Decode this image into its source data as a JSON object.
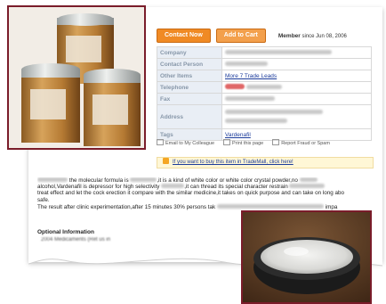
{
  "actions": {
    "contact_label": "Contact Now",
    "cart_label": "Add to Cart",
    "member_bold": "Member",
    "member_text": "since Jun 08, 2006"
  },
  "info_rows": [
    {
      "label": "Company",
      "value": ""
    },
    {
      "label": "Contact Person",
      "value": ""
    },
    {
      "label": "Other Items",
      "value": "More 7 Trade Leads"
    },
    {
      "label": "Telephone",
      "value": ""
    },
    {
      "label": "Fax",
      "value": ""
    },
    {
      "label": "Address",
      "value": ""
    },
    {
      "label": "Tags",
      "value": "Vardenafil"
    }
  ],
  "utility": {
    "email": "Email to My Colleague",
    "print": "Print this page",
    "report": "Report Fraud or Spam"
  },
  "trademall_link": "If you want to buy this item in TradeMall, click here!",
  "description": [
    "the molecular formula is",
    ",it is a kind of white color or white color crystal powder,no",
    "alcohol,Vardenafil is depressor for high selectivity",
    ",it can thread its special character restrain",
    "treat effect and let the cock erection it compare with the similar medicine,it takes on quick purpose and can take on long abo",
    "safe.",
    "The result after clinic experimentation,after 15 minutes 30% persons tak",
    "impa"
  ],
  "optional_title": "Optional Information",
  "optional_sub": "2004 Medicaments (Ret us in"
}
